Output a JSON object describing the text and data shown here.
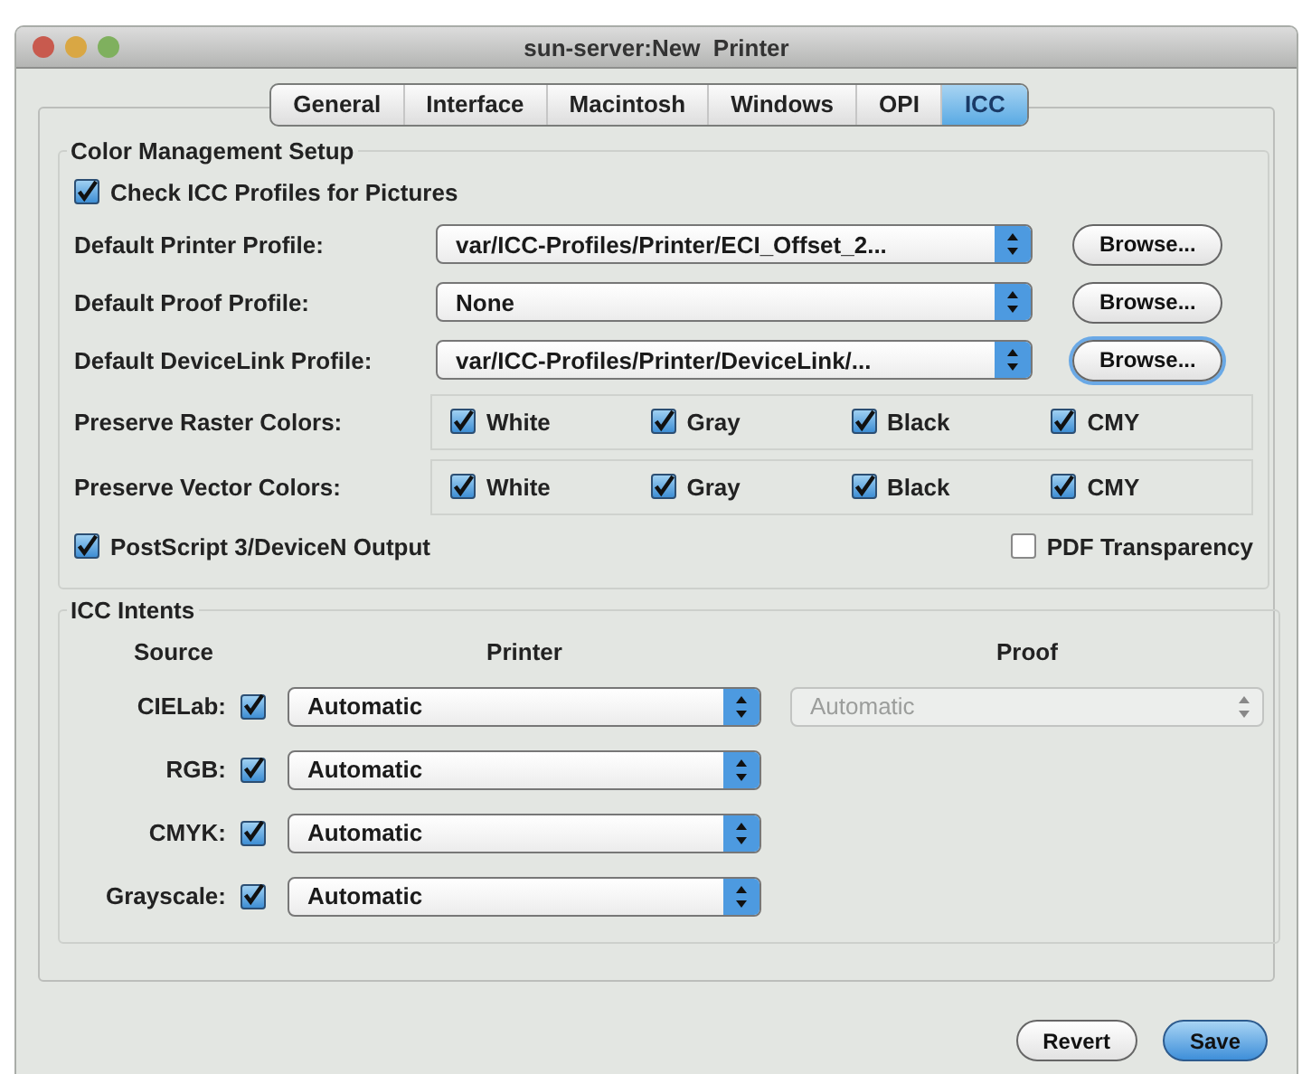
{
  "window": {
    "title": "sun-server:New  Printer"
  },
  "tabs": [
    {
      "label": "General",
      "selected": false
    },
    {
      "label": "Interface",
      "selected": false
    },
    {
      "label": "Macintosh",
      "selected": false
    },
    {
      "label": "Windows",
      "selected": false
    },
    {
      "label": "OPI",
      "selected": false
    },
    {
      "label": "ICC",
      "selected": true
    }
  ],
  "color_management": {
    "title": "Color Management Setup",
    "check_icc": {
      "label": "Check ICC Profiles for Pictures",
      "checked": true
    },
    "profiles": [
      {
        "label": "Default Printer Profile:",
        "value": "var/ICC-Profiles/Printer/ECI_Offset_2...",
        "button": "Browse...",
        "focused": false
      },
      {
        "label": "Default Proof Profile:",
        "value": "None",
        "button": "Browse...",
        "focused": false
      },
      {
        "label": "Default DeviceLink Profile:",
        "value": "var/ICC-Profiles/Printer/DeviceLink/...",
        "button": "Browse...",
        "focused": true
      }
    ],
    "preserve": [
      {
        "label": "Preserve Raster Colors:",
        "options": [
          {
            "label": "White",
            "checked": true
          },
          {
            "label": "Gray",
            "checked": true
          },
          {
            "label": "Black",
            "checked": true
          },
          {
            "label": "CMY",
            "checked": true
          }
        ]
      },
      {
        "label": "Preserve Vector Colors:",
        "options": [
          {
            "label": "White",
            "checked": true
          },
          {
            "label": "Gray",
            "checked": true
          },
          {
            "label": "Black",
            "checked": true
          },
          {
            "label": "CMY",
            "checked": true
          }
        ]
      }
    ],
    "postscript": {
      "label": "PostScript 3/DeviceN Output",
      "checked": true
    },
    "pdf_transparency": {
      "label": "PDF Transparency",
      "checked": false
    }
  },
  "icc_intents": {
    "title": "ICC Intents",
    "headers": [
      "Source",
      "Printer",
      "Proof"
    ],
    "rows": [
      {
        "label": "CIELab:",
        "checked": true,
        "printer": "Automatic",
        "proof": {
          "value": "Automatic",
          "disabled": true
        }
      },
      {
        "label": "RGB:",
        "checked": true,
        "printer": "Automatic"
      },
      {
        "label": "CMYK:",
        "checked": true,
        "printer": "Automatic"
      },
      {
        "label": "Grayscale:",
        "checked": true,
        "printer": "Automatic"
      }
    ]
  },
  "buttons": [
    {
      "label": "Revert",
      "kind": "normal"
    },
    {
      "label": "Save",
      "kind": "default"
    }
  ]
}
